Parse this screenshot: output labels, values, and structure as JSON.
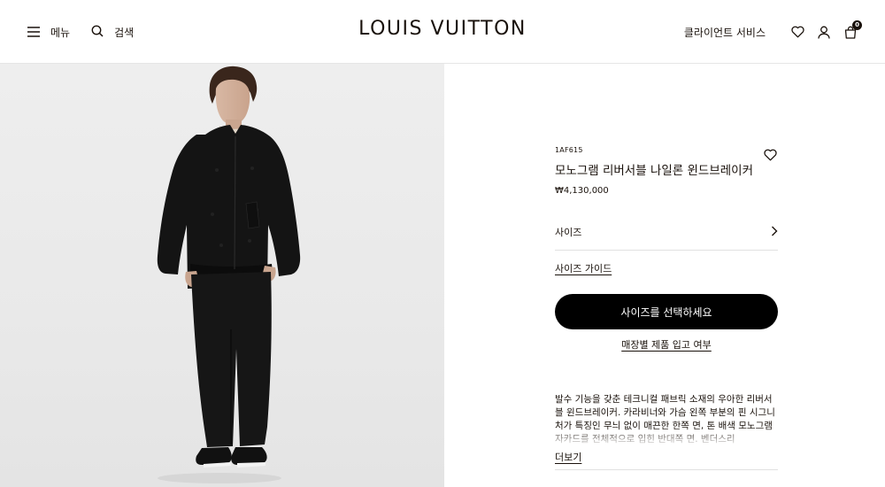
{
  "header": {
    "menu_label": "메뉴",
    "search_label": "검색",
    "logo": "LOUIS VUITTON",
    "client_service_label": "클라이언트 서비스",
    "bag_count": "0"
  },
  "product": {
    "sku": "1AF615",
    "name": "모노그램 리버서블 나일론 윈드브레이커",
    "price": "₩4,130,000",
    "size_label": "사이즈",
    "size_guide_label": "사이즈 가이드",
    "select_size_button": "사이즈를 선택하세요",
    "store_availability_link": "매장별 제품 입고 여부",
    "description": "발수 기능을 갖춘 테크니컬 패브릭 소재의 우아한 리버서블 윈드브레이커. 카라비너와 가슴 왼쪽 부분의 핀 시그니처가 특징인 무늬 없이 매끈한 한쪽 면, 톤 배색 모노그램 자카드를 전체적으로 입힌 반대쪽 면. 벤더스리",
    "read_more_label": "더보기"
  },
  "icons": {
    "menu": "hamburger-icon",
    "search": "search-icon",
    "wishlist": "heart-icon",
    "account": "user-icon",
    "bag": "shopping-bag-icon"
  },
  "colors": {
    "text": "#19110b",
    "button": "#000000",
    "image_bg": "#eaeaea"
  }
}
